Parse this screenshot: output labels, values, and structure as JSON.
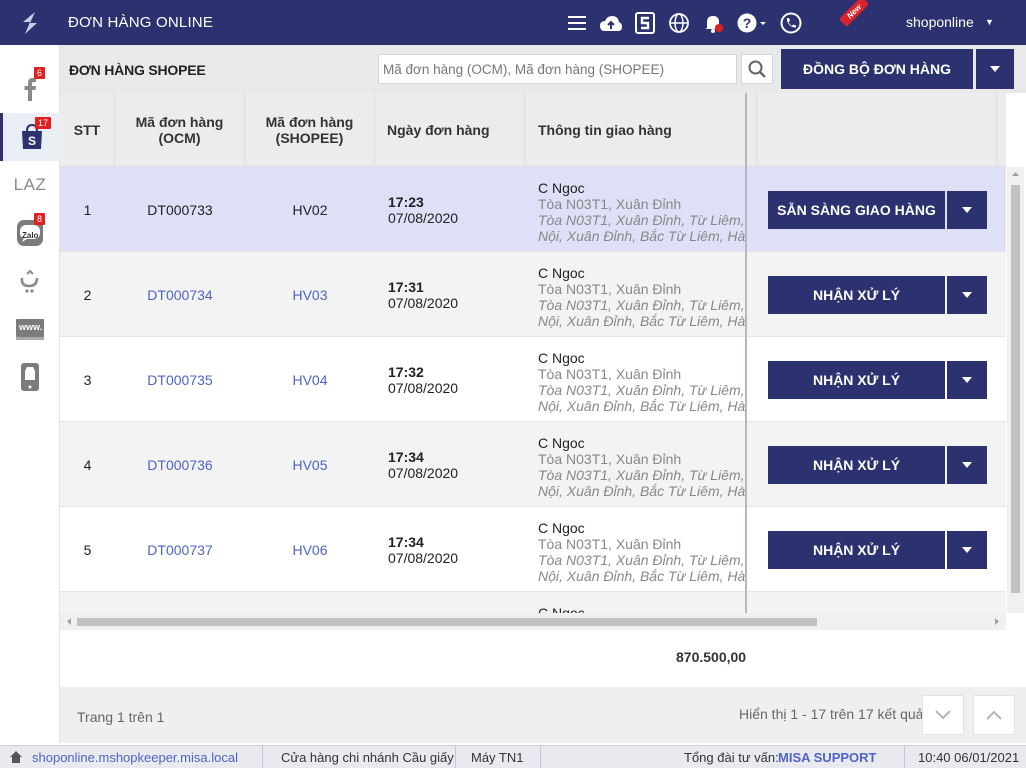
{
  "app": {
    "title": "ĐƠN HÀNG ONLINE",
    "user": "shoponline",
    "new_badge": "New"
  },
  "sidebar": {
    "items": [
      {
        "name": "facebook",
        "badge": "6"
      },
      {
        "name": "shopee",
        "badge": "17"
      },
      {
        "name": "lazada",
        "label": "LAZ"
      },
      {
        "name": "zalo",
        "label": "Zalo",
        "badge": "8"
      },
      {
        "name": "tiki"
      },
      {
        "name": "website",
        "label": "www."
      },
      {
        "name": "mobile-app"
      }
    ]
  },
  "header": {
    "title": "ĐƠN HÀNG SHOPEE",
    "search_placeholder": "Mã đơn hàng (OCM), Mã đơn hàng (SHOPEE)",
    "sync_label": "ĐỒNG BỘ ĐƠN HÀNG"
  },
  "table": {
    "columns": {
      "stt": "STT",
      "ocm_1": "Mã đơn hàng",
      "ocm_2": "(OCM)",
      "shopee_1": "Mã đơn hàng",
      "shopee_2": "(SHOPEE)",
      "date": "Ngày đơn hàng",
      "ship": "Thông tin giao hàng"
    },
    "rows": [
      {
        "stt": "1",
        "ocm": "DT000733",
        "shopee": "HV02",
        "time": "17:23",
        "date": "07/08/2020",
        "name": "C Ngoc",
        "addr1": "Tòa N03T1, Xuân Đỉnh",
        "addr2a": "Tòa N03T1, Xuân Đỉnh, Từ Liêm, Hà",
        "addr2b": "Nội, Xuân Đỉnh, Bắc Từ Liêm, Hà Nội",
        "action": "SẴN SÀNG GIAO HÀNG"
      },
      {
        "stt": "2",
        "ocm": "DT000734",
        "shopee": "HV03",
        "time": "17:31",
        "date": "07/08/2020",
        "name": "C Ngoc",
        "addr1": "Tòa N03T1, Xuân Đỉnh",
        "addr2a": "Tòa N03T1, Xuân Đỉnh, Từ Liêm, Hà",
        "addr2b": "Nội, Xuân Đỉnh, Bắc Từ Liêm, Hà Nội",
        "action": "NHẬN XỬ LÝ"
      },
      {
        "stt": "3",
        "ocm": "DT000735",
        "shopee": "HV04",
        "time": "17:32",
        "date": "07/08/2020",
        "name": "C Ngoc",
        "addr1": "Tòa N03T1, Xuân Đỉnh",
        "addr2a": "Tòa N03T1, Xuân Đỉnh, Từ Liêm, Hà",
        "addr2b": "Nội, Xuân Đỉnh, Bắc Từ Liêm, Hà Nội",
        "action": "NHẬN XỬ LÝ"
      },
      {
        "stt": "4",
        "ocm": "DT000736",
        "shopee": "HV05",
        "time": "17:34",
        "date": "07/08/2020",
        "name": "C Ngoc",
        "addr1": "Tòa N03T1, Xuân Đỉnh",
        "addr2a": "Tòa N03T1, Xuân Đỉnh, Từ Liêm, Hà",
        "addr2b": "Nội, Xuân Đỉnh, Bắc Từ Liêm, Hà Nội",
        "action": "NHẬN XỬ LÝ"
      },
      {
        "stt": "5",
        "ocm": "DT000737",
        "shopee": "HV06",
        "time": "17:34",
        "date": "07/08/2020",
        "name": "C Ngoc",
        "addr1": "Tòa N03T1, Xuân Đỉnh",
        "addr2a": "Tòa N03T1, Xuân Đỉnh, Từ Liêm, Hà",
        "addr2b": "Nội, Xuân Đỉnh, Bắc Từ Liêm, Hà Nội",
        "action": "NHẬN XỬ LÝ"
      },
      {
        "name": "C Ngoc"
      }
    ],
    "total": "870.500,00"
  },
  "pager": {
    "page_text": "Trang 1 trên 1",
    "result_text": "Hiển thị 1 - 17 trên 17 kết quả"
  },
  "status": {
    "url": "shoponline.mshopkeeper.misa.local",
    "branch": "Cửa hàng chi nhánh Cầu giấy",
    "machine": "Máy TN1",
    "hotline_label": "Tổng đài tư vấn:",
    "hotline_name": "MISA SUPPORT",
    "datetime": "10:40 06/01/2021"
  },
  "colors": {
    "primary": "#2c3170",
    "link": "#4e64c6",
    "selected_row": "#dde0f6",
    "badge": "#e02020"
  }
}
